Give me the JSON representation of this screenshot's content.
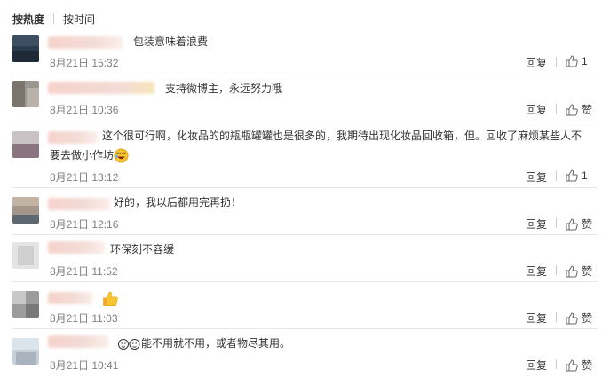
{
  "sort": {
    "hot": "按热度",
    "time": "按时间"
  },
  "comments": [
    {
      "text": "包装意味着浪费",
      "time": "8月21日 15:32",
      "reply": "回复",
      "like": "1"
    },
    {
      "text": "支持微博主，永远努力哦",
      "time": "8月21日 10:36",
      "reply": "回复",
      "like": "赞"
    },
    {
      "text": "这个很可行啊，化妆品的的瓶瓶罐罐也是很多的，我期待出现化妆品回收箱，但。回收了麻烦某些人不",
      "text2": "要去做小作坊",
      "time": "8月21日 13:12",
      "reply": "回复",
      "like": "1"
    },
    {
      "text": "好的，我以后都用完再扔！",
      "time": "8月21日 12:16",
      "reply": "回复",
      "like": "赞"
    },
    {
      "text": "环保刻不容缓",
      "time": "8月21日 11:52",
      "reply": "回复",
      "like": "赞"
    },
    {
      "text": "",
      "time": "8月21日 11:03",
      "reply": "回复",
      "like": "赞"
    },
    {
      "text": "能不用就不用，或者物尽其用。",
      "time": "8月21日 10:41",
      "reply": "回复",
      "like": "赞"
    }
  ]
}
